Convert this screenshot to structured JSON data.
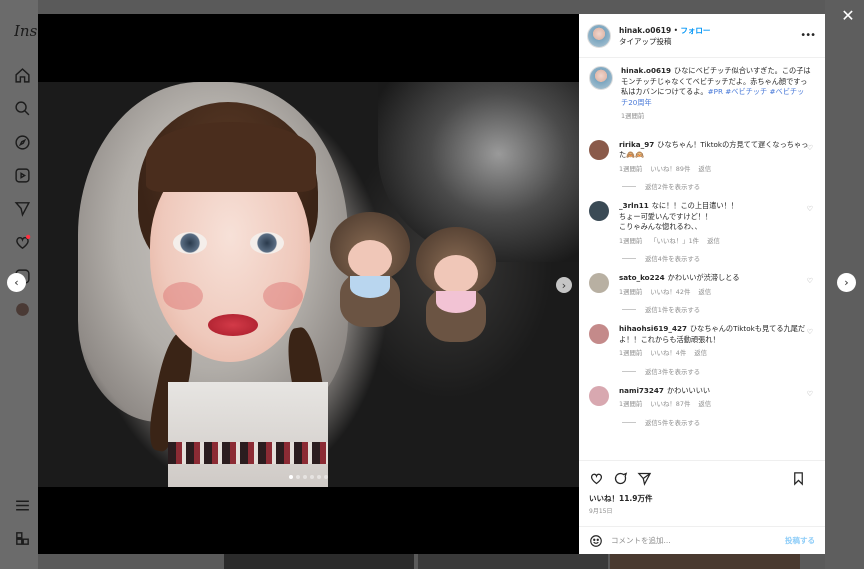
{
  "background": {
    "logo": "Instagram",
    "nav_icons": [
      "home-icon",
      "search-icon",
      "explore-icon",
      "reels-icon",
      "messages-icon",
      "notifications-icon",
      "create-icon",
      "profile-icon",
      "more-menu-icon",
      "meta-icon"
    ]
  },
  "post": {
    "username": "hinak.o0619",
    "separator": "•",
    "follow_label": "フォロー",
    "subtitle": "タイアップ投稿",
    "more_icon": "more-horizontal-icon",
    "caption": {
      "username": "hinak.o0619",
      "text": "ひなにベビチッチ似合いすぎた。この子はモンチッチじゃなくてベビチッチだよ。赤ちゃん顔ですっ私はカバンにつけてるよ。",
      "tags": "#PR #ベビチッチ #ベビチッチ20周年",
      "time": "1週間前"
    },
    "photo_count": 6,
    "photo_index": 1
  },
  "comments": [
    {
      "user": "ririka_97",
      "text": "ひなちゃん！Tiktokの方見てて遅くなっちゃった🙈🙉",
      "time": "1週間前",
      "likes": "いいね！89件",
      "reply": "返信",
      "replies": "返信2件を表示する",
      "avatar_color": "#8a5a4a"
    },
    {
      "user": "_3rln11",
      "text": "なに！！この上目遣い！！\nちょー可愛いんですけど！！\nこりゃみんな惚れるわ、、",
      "time": "1週間前",
      "likes": "「いいね！」1件",
      "reply": "返信",
      "replies": "返信4件を表示する",
      "avatar_color": "#3a4a55"
    },
    {
      "user": "sato_ko224",
      "text": "かわいいが渋滞しとる",
      "time": "1週間前",
      "likes": "いいね！42件",
      "reply": "返信",
      "replies": "返信1件を表示する",
      "avatar_color": "#b8b0a2"
    },
    {
      "user": "hihaohsi619_427",
      "text": "ひなちゃんのTiktokも見てる九尾だよ！！これからも活動頑張れ！",
      "time": "1週間前",
      "likes": "いいね！4件",
      "reply": "返信",
      "replies": "返信3件を表示する",
      "avatar_color": "#c48a8a"
    },
    {
      "user": "nami73247",
      "text": "かわいいいい",
      "time": "1週間前",
      "likes": "いいね！87件",
      "reply": "返信",
      "replies": "返信5件を表示する",
      "avatar_color": "#d8a8b0"
    }
  ],
  "actions": {
    "likes": "いいね！11.9万件",
    "date": "9月15日",
    "comment_placeholder": "コメントを追加...",
    "post_label": "投稿する"
  },
  "colors": {
    "link_blue": "#0095f6",
    "hashtag": "#00376b",
    "muted": "#8e8e8e"
  }
}
